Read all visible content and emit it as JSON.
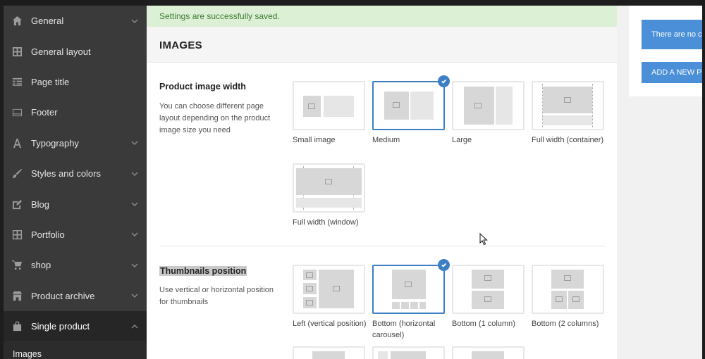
{
  "notice": "Settings are successfully saved.",
  "section_title": "IMAGES",
  "sidebar": {
    "items": [
      {
        "label": "General",
        "icon": "home-icon",
        "chevron": true
      },
      {
        "label": "General layout",
        "icon": "layout-icon",
        "chevron": false
      },
      {
        "label": "Page title",
        "icon": "page-title-icon",
        "chevron": false
      },
      {
        "label": "Footer",
        "icon": "footer-icon",
        "chevron": false
      },
      {
        "label": "Typography",
        "icon": "typography-icon",
        "chevron": true
      },
      {
        "label": "Styles and colors",
        "icon": "brush-icon",
        "chevron": true
      },
      {
        "label": "Blog",
        "icon": "edit-icon",
        "chevron": true
      },
      {
        "label": "Portfolio",
        "icon": "grid-icon",
        "chevron": true
      },
      {
        "label": "shop",
        "icon": "cart-icon",
        "chevron": true
      },
      {
        "label": "Product archive",
        "icon": "store-icon",
        "chevron": true
      },
      {
        "label": "Single product",
        "icon": "bag-icon",
        "chevron": true,
        "active": true
      }
    ],
    "sub_item": "Images"
  },
  "options": {
    "product_image_width": {
      "title": "Product image width",
      "description": "You can choose different page layout depending on the product image size you need",
      "choices": [
        "Small image",
        "Medium",
        "Large",
        "Full width (container)",
        "Full width (window)"
      ],
      "selected": "Medium"
    },
    "thumbnails_position": {
      "title": "Thumbnails position",
      "description": "Use vertical or horizontal position for thumbnails",
      "choices": [
        "Left (vertical position)",
        "Bottom (horizontal carousel)",
        "Bottom (1 column)",
        "Bottom (2 columns)"
      ],
      "selected": "Bottom (horizontal carousel)"
    }
  },
  "right_panel": {
    "info_text": "There are no c",
    "add_button": "ADD A NEW PR"
  },
  "colors": {
    "accent": "#3d7fc4",
    "notice_bg": "#dcf0d5",
    "notice_text": "#3c7a33",
    "sidebar_bg": "#3a3a3a"
  }
}
